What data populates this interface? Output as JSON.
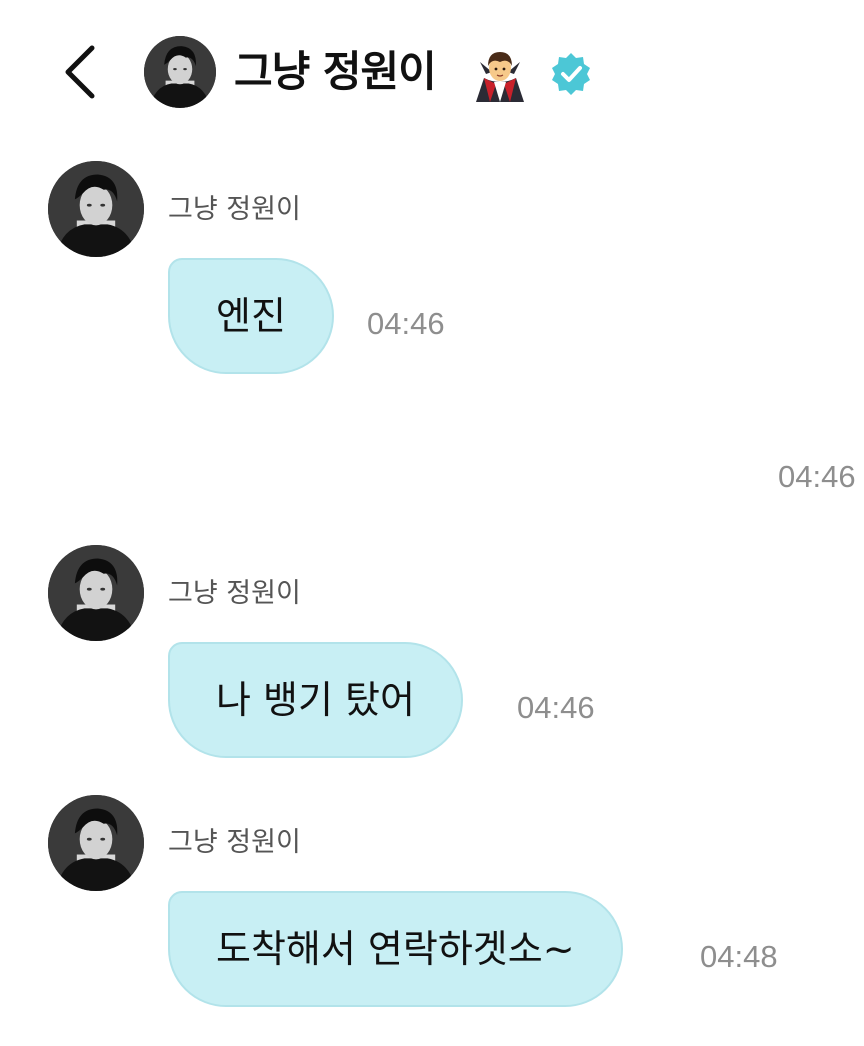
{
  "header": {
    "back_icon": "chevron-left-icon",
    "contact_name": "그냥 정원이",
    "emoji_icon": "vampire-emoji-icon",
    "verified_icon": "verified-badge-icon",
    "accent_color": "#4cc7d6"
  },
  "messages": [
    {
      "sender": "그냥 정원이",
      "text": "엔진",
      "time": "04:46"
    },
    {
      "sender": "그냥 정원이",
      "text": "나 뱅기 탔어",
      "time": "04:46"
    },
    {
      "sender": "그냥 정원이",
      "text": "도착해서 연락하겟소~",
      "time": "04:48"
    }
  ],
  "outgoing": {
    "time": "04:46"
  },
  "colors": {
    "bubble_bg": "#c8eff4",
    "time_text": "#8e8e8e",
    "sender_text": "#555555"
  }
}
